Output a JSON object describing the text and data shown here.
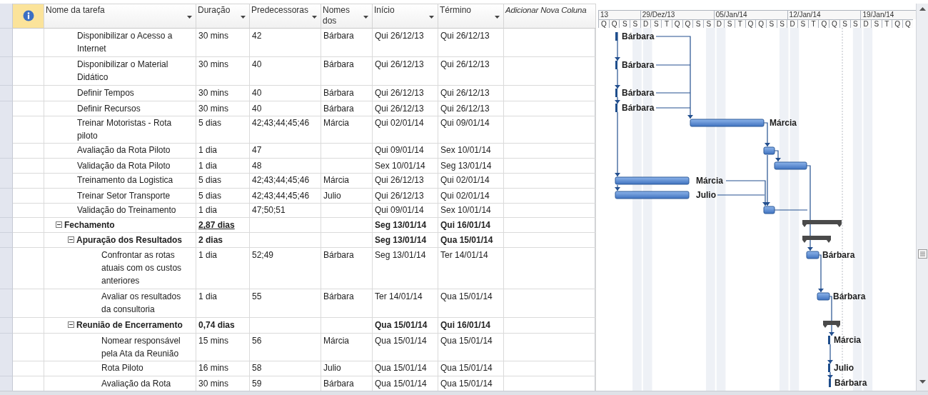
{
  "table": {
    "columns": [
      {
        "label": "Nome da tarefa",
        "kind": "field"
      },
      {
        "label": "Duração",
        "kind": "field"
      },
      {
        "label": "Predecessoras",
        "kind": "field"
      },
      {
        "label": "Nomes dos",
        "kind": "field"
      },
      {
        "label": "Início",
        "kind": "field"
      },
      {
        "label": "Término",
        "kind": "field"
      },
      {
        "label": "Adicionar Nova Coluna",
        "kind": "add"
      }
    ]
  },
  "tasks": [
    {
      "kind": "task",
      "name": "Disponibilizar o Acesso a Internet",
      "duration": "30 mins",
      "predecessors": "42",
      "resources": "Bárbara",
      "start": "Qui 26/12/13",
      "finish": "Qui 26/12/13",
      "bar": {
        "kind": "short",
        "label": "Bárbara"
      }
    },
    {
      "kind": "task",
      "name": "Disponibilizar o Material Didático",
      "duration": "30 mins",
      "predecessors": "40",
      "resources": "Bárbara",
      "start": "Qui 26/12/13",
      "finish": "Qui 26/12/13",
      "bar": {
        "kind": "short",
        "label": "Bárbara"
      }
    },
    {
      "kind": "task",
      "name": "Definir Tempos",
      "duration": "30 mins",
      "predecessors": "40",
      "resources": "Bárbara",
      "start": "Qui 26/12/13",
      "finish": "Qui 26/12/13",
      "bar": {
        "kind": "short",
        "label": "Bárbara"
      }
    },
    {
      "kind": "task",
      "name": "Definir Recursos",
      "duration": "30 mins",
      "predecessors": "40",
      "resources": "Bárbara",
      "start": "Qui 26/12/13",
      "finish": "Qui 26/12/13",
      "bar": {
        "kind": "short",
        "label": "Bárbara"
      }
    },
    {
      "kind": "task",
      "name": "Treinar Motoristas - Rota piloto",
      "duration": "5 dias",
      "predecessors": "42;43;44;45;46",
      "resources": "Márcia",
      "start": "Qui 02/01/14",
      "finish": "Qui 09/01/14",
      "bar": {
        "kind": "task",
        "label": "Márcia"
      }
    },
    {
      "kind": "task",
      "name": "Avaliação da Rota Piloto",
      "duration": "1 dia",
      "predecessors": "47",
      "start": "Qui 09/01/14",
      "finish": "Sex 10/01/14",
      "bar": {
        "kind": "task"
      }
    },
    {
      "kind": "task",
      "name": "Validação da Rota Piloto",
      "duration": "1 dia",
      "predecessors": "48",
      "start": "Sex 10/01/14",
      "finish": "Seg 13/01/14",
      "bar": {
        "kind": "task"
      }
    },
    {
      "kind": "task",
      "name": "Treinamento da Logistica",
      "duration": "5 dias",
      "predecessors": "42;43;44;45;46",
      "resources": "Márcia",
      "start": "Qui 26/12/13",
      "finish": "Qui 02/01/14",
      "bar": {
        "kind": "task",
        "label": "Márcia"
      }
    },
    {
      "kind": "task",
      "name": "Treinar Setor Transporte",
      "duration": "5 dias",
      "predecessors": "42;43;44;45;46",
      "resources": "Julio",
      "start": "Qui 26/12/13",
      "finish": "Qui 02/01/14",
      "bar": {
        "kind": "task",
        "label": "Julio"
      }
    },
    {
      "kind": "task",
      "name": "Validação do Treinamento",
      "duration": "1 dia",
      "predecessors": "47;50;51",
      "start": "Qui 09/01/14",
      "finish": "Sex 10/01/14",
      "bar": {
        "kind": "task"
      }
    },
    {
      "kind": "summary",
      "name": "Fechamento",
      "duration": "2,87 dias",
      "duration_underlined": true,
      "start": "Seg 13/01/14",
      "finish": "Qui 16/01/14",
      "expanded": true,
      "bar": {
        "kind": "summary"
      },
      "children": [
        {
          "kind": "summary",
          "name": "Apuração dos Resultados",
          "duration": "2 dias",
          "duration_underlined": false,
          "start": "Seg 13/01/14",
          "finish": "Qua 15/01/14",
          "expanded": true,
          "bar": {
            "kind": "summary"
          },
          "children": [
            {
              "kind": "task",
              "name": "Confrontar as rotas atuais com os custos anteriores",
              "duration": "1 dia",
              "predecessors": "52;49",
              "resources": "Bárbara",
              "start": "Seg 13/01/14",
              "finish": "Ter 14/01/14",
              "bar": {
                "kind": "task",
                "label": "Bárbara"
              }
            },
            {
              "kind": "task",
              "name": "Avaliar os resultados da consultoria",
              "duration": "1 dia",
              "predecessors": "55",
              "resources": "Bárbara",
              "start": "Ter 14/01/14",
              "finish": "Qua 15/01/14",
              "bar": {
                "kind": "task",
                "label": "Bárbara"
              }
            }
          ]
        },
        {
          "kind": "summary",
          "name": "Reunião de Encerramento",
          "duration": "0,74 dias",
          "duration_underlined": false,
          "start": "Qua 15/01/14",
          "finish": "Qui 16/01/14",
          "expanded": true,
          "bar": {
            "kind": "summary"
          },
          "children": [
            {
              "kind": "task",
              "name": "Nomear responsável pela Ata da Reunião",
              "duration": "15 mins",
              "predecessors": "56",
              "resources": "Márcia",
              "start": "Qua 15/01/14",
              "finish": "Qua 15/01/14",
              "bar": {
                "kind": "short",
                "label": "Márcia"
              }
            },
            {
              "kind": "task",
              "name": "Rota Piloto",
              "duration": "16 mins",
              "predecessors": "58",
              "resources": "Julio",
              "start": "Qua 15/01/14",
              "finish": "Qua 15/01/14",
              "bar": {
                "kind": "short",
                "label": "Julio"
              }
            },
            {
              "kind": "task",
              "name": "Avaliação da Rota",
              "duration": "30 mins",
              "predecessors": "59",
              "resources": "Bárbara",
              "start": "Qua 15/01/14",
              "finish": "Qua 15/01/14",
              "bar": {
                "kind": "short",
                "label": "Bárbara"
              }
            }
          ]
        }
      ]
    }
  ],
  "timescale": {
    "weeks": [
      "13",
      "29/Dez/13",
      "05/Jan/14",
      "12/Jan/14",
      "19/Jan/14"
    ],
    "days": [
      "Q",
      "Q",
      "S",
      "S",
      "D",
      "S",
      "T",
      "Q",
      "Q",
      "S",
      "S",
      "D",
      "S",
      "T",
      "Q",
      "Q",
      "S",
      "S",
      "D",
      "S",
      "T",
      "Q",
      "Q",
      "S",
      "S",
      "D",
      "S",
      "T",
      "Q",
      "Q"
    ]
  }
}
